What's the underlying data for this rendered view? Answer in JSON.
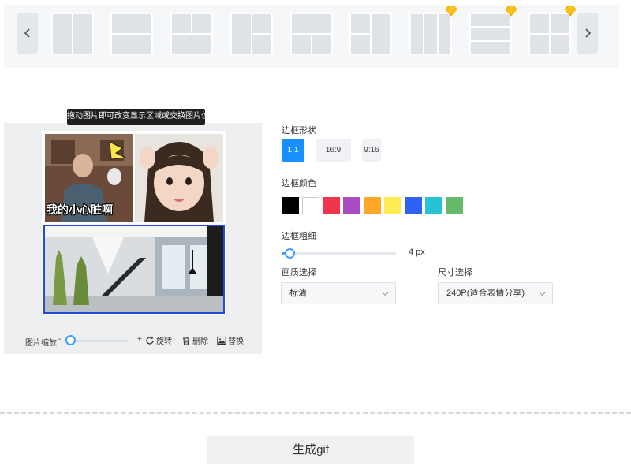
{
  "layout_bar": {
    "prev_icon": "chevron-left-icon",
    "next_icon": "chevron-right-icon",
    "templates": [
      {
        "id": "two-columns",
        "premium": false
      },
      {
        "id": "two-rows",
        "premium": false
      },
      {
        "id": "one-top-two-bottom",
        "premium": false
      },
      {
        "id": "one-left-two-right",
        "premium": false
      },
      {
        "id": "one-top-two-bottom-alt",
        "premium": false
      },
      {
        "id": "two-left-one-right",
        "premium": false
      },
      {
        "id": "three-columns",
        "premium": true
      },
      {
        "id": "three-rows",
        "premium": true
      },
      {
        "id": "grid-four",
        "premium": true
      }
    ]
  },
  "editor": {
    "tooltip": "拖动图片即可改变显示区域或交换图片位置",
    "images": [
      {
        "name": "meme-old-man",
        "caption": "我的小心脏啊"
      },
      {
        "name": "little-girl-photo"
      },
      {
        "name": "interior-staircase-photo"
      }
    ],
    "zoom_label": "图片缩放:",
    "zoom_minus": "-",
    "zoom_plus": "+",
    "zoom_value": 0,
    "tools": {
      "rotate": "旋转",
      "delete": "删除",
      "replace": "替换"
    }
  },
  "settings": {
    "shape_label": "边框形状",
    "ratios": [
      {
        "label": "1:1",
        "active": true
      },
      {
        "label": "16:9",
        "active": false
      },
      {
        "label": "9:16",
        "active": false
      }
    ],
    "color_label": "边框颜色",
    "colors": [
      "#000000",
      "#ffffff",
      "#f0364f",
      "#a84dc4",
      "#ffa827",
      "#ffeb55",
      "#2f62f3",
      "#26c2d6",
      "#66bb6a"
    ],
    "thickness_label": "边框粗细",
    "thickness_value": "4 px",
    "thickness_fraction": 0.04,
    "quality_label": "画质选择",
    "quality_value": "标清",
    "size_label": "尺寸选择",
    "size_value": "240P(适合表情分享)"
  },
  "generate_label": "生成gif",
  "accent": "#1890ff"
}
